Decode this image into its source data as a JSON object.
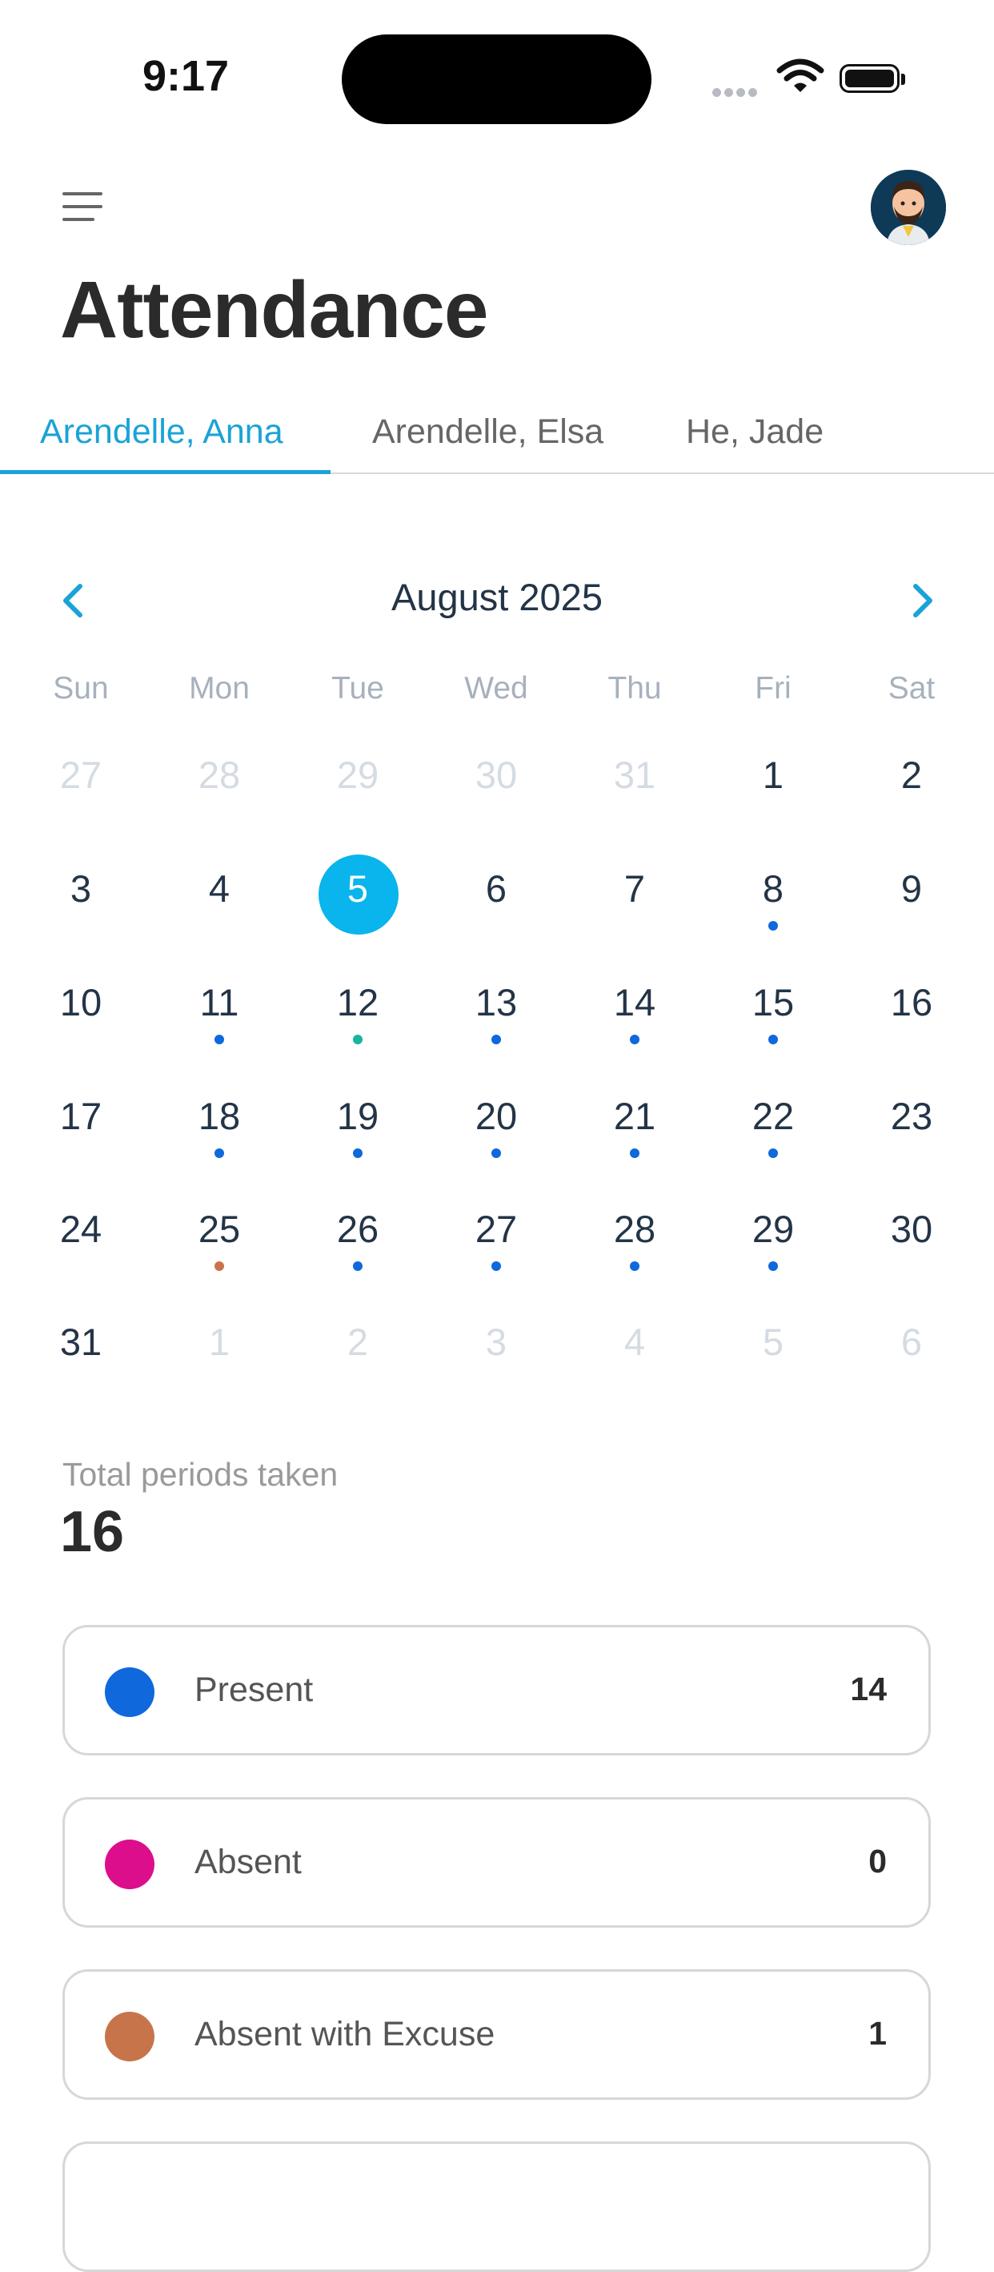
{
  "status_bar": {
    "time": "9:17"
  },
  "header": {
    "title": "Attendance"
  },
  "tabs": [
    {
      "label": "Arendelle, Anna",
      "active": true
    },
    {
      "label": "Arendelle, Elsa",
      "active": false
    },
    {
      "label": "He, Jade",
      "active": false
    }
  ],
  "calendar": {
    "month_label": "August 2025",
    "weekdays": [
      "Sun",
      "Mon",
      "Tue",
      "Wed",
      "Thu",
      "Fri",
      "Sat"
    ],
    "selected_day": "5",
    "weeks": [
      [
        {
          "d": "27",
          "m": true
        },
        {
          "d": "28",
          "m": true
        },
        {
          "d": "29",
          "m": true
        },
        {
          "d": "30",
          "m": true
        },
        {
          "d": "31",
          "m": true
        },
        {
          "d": "1"
        },
        {
          "d": "2"
        }
      ],
      [
        {
          "d": "3"
        },
        {
          "d": "4"
        },
        {
          "d": "5",
          "sel": true
        },
        {
          "d": "6"
        },
        {
          "d": "7"
        },
        {
          "d": "8",
          "dot": "present"
        },
        {
          "d": "9"
        }
      ],
      [
        {
          "d": "10"
        },
        {
          "d": "11",
          "dot": "present"
        },
        {
          "d": "12",
          "dot": "teal"
        },
        {
          "d": "13",
          "dot": "present"
        },
        {
          "d": "14",
          "dot": "present"
        },
        {
          "d": "15",
          "dot": "present"
        },
        {
          "d": "16"
        }
      ],
      [
        {
          "d": "17"
        },
        {
          "d": "18",
          "dot": "present"
        },
        {
          "d": "19",
          "dot": "present"
        },
        {
          "d": "20",
          "dot": "present"
        },
        {
          "d": "21",
          "dot": "present"
        },
        {
          "d": "22",
          "dot": "present"
        },
        {
          "d": "23"
        }
      ],
      [
        {
          "d": "24"
        },
        {
          "d": "25",
          "dot": "excuse"
        },
        {
          "d": "26",
          "dot": "present"
        },
        {
          "d": "27",
          "dot": "present"
        },
        {
          "d": "28",
          "dot": "present"
        },
        {
          "d": "29",
          "dot": "present"
        },
        {
          "d": "30"
        }
      ],
      [
        {
          "d": "31"
        },
        {
          "d": "1",
          "m": true
        },
        {
          "d": "2",
          "m": true
        },
        {
          "d": "3",
          "m": true
        },
        {
          "d": "4",
          "m": true
        },
        {
          "d": "5",
          "m": true
        },
        {
          "d": "6",
          "m": true
        }
      ]
    ]
  },
  "summary": {
    "total_label": "Total periods taken",
    "total_value": "16",
    "stats": [
      {
        "label": "Present",
        "count": "14",
        "color": "#0f68dc"
      },
      {
        "label": "Absent",
        "count": "0",
        "color": "#dc0e8c"
      },
      {
        "label": "Absent with Excuse",
        "count": "1",
        "color": "#c8744a"
      }
    ]
  },
  "colors": {
    "accent": "#1aa3d6",
    "selected_day": "#0ab4ec",
    "dot_present": "#0f68dc",
    "dot_teal": "#18b5a0",
    "dot_excuse": "#c8744a"
  },
  "icons": {
    "menu": "hamburger-icon",
    "prev": "chevron-left-icon",
    "next": "chevron-right-icon",
    "avatar": "user-avatar"
  }
}
